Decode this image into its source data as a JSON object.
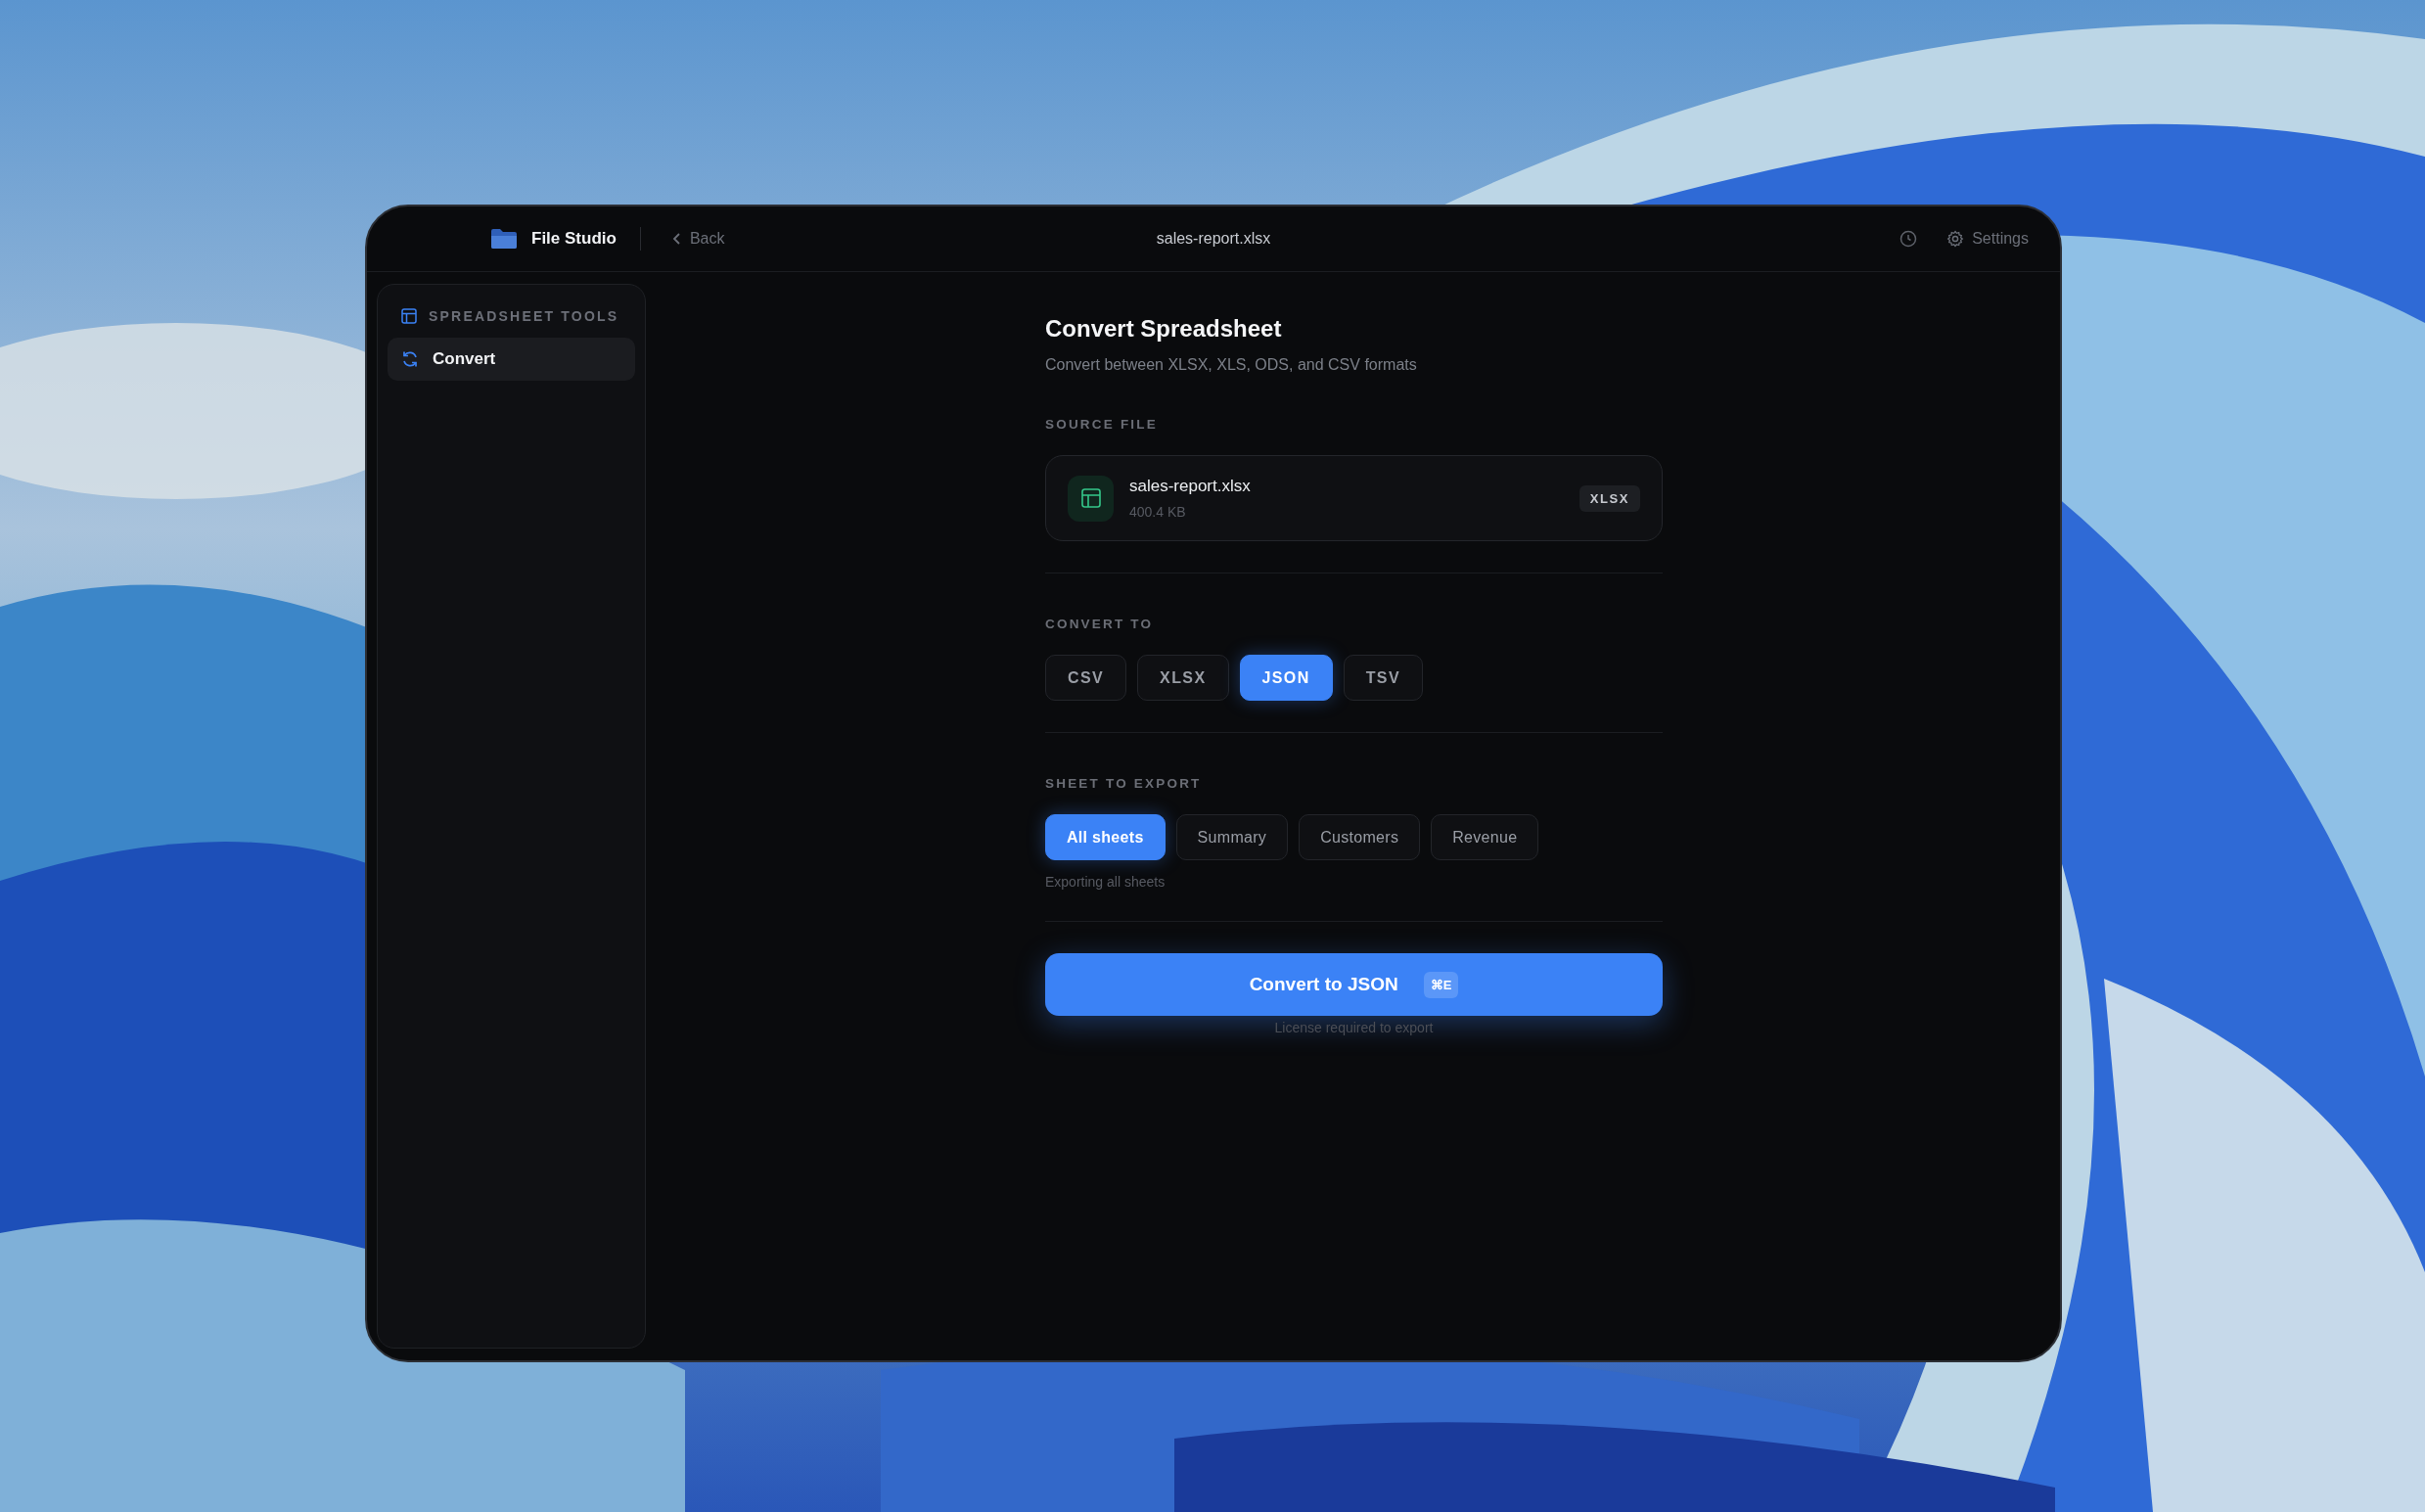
{
  "app": {
    "name": "File Studio"
  },
  "topbar": {
    "back": "Back",
    "filename": "sales-report.xlsx",
    "settings": "Settings"
  },
  "sidebar": {
    "section": "SPREADSHEET TOOLS",
    "items": [
      {
        "label": "Convert",
        "selected": true
      }
    ]
  },
  "page": {
    "title": "Convert Spreadsheet",
    "subtitle": "Convert between XLSX, XLS, ODS, and CSV formats"
  },
  "source": {
    "label": "SOURCE FILE",
    "file_name": "sales-report.xlsx",
    "size": "400.4 KB",
    "badge": "XLSX"
  },
  "convert_to": {
    "label": "CONVERT TO",
    "options": [
      {
        "label": "CSV",
        "selected": false
      },
      {
        "label": "XLSX",
        "selected": false
      },
      {
        "label": "JSON",
        "selected": true
      },
      {
        "label": "TSV",
        "selected": false
      }
    ]
  },
  "sheets": {
    "label": "SHEET TO EXPORT",
    "options": [
      {
        "label": "All sheets",
        "selected": true
      },
      {
        "label": "Summary",
        "selected": false
      },
      {
        "label": "Customers",
        "selected": false
      },
      {
        "label": "Revenue",
        "selected": false
      }
    ],
    "hint": "Exporting all sheets"
  },
  "action": {
    "label": "Convert to JSON",
    "shortcut": "⌘E",
    "note": "License required to export"
  }
}
